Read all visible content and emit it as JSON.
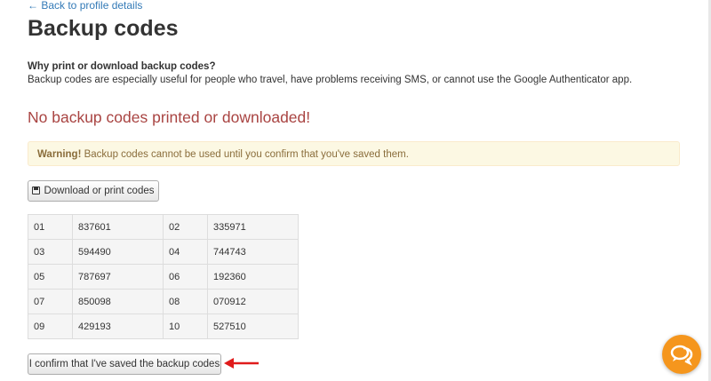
{
  "nav": {
    "back_label": "← Back to profile details"
  },
  "page": {
    "title": "Backup codes"
  },
  "info": {
    "question": "Why print or download backup codes?",
    "explanation": "Backup codes are especially useful for people who travel, have problems receiving SMS, or cannot use the Google Authenticator app."
  },
  "status": {
    "message": "No backup codes printed or downloaded!"
  },
  "warning": {
    "label": "Warning!",
    "text": " Backup codes cannot be used until you confirm that you've saved them."
  },
  "actions": {
    "download_label": "Download or print codes",
    "confirm_label": "I confirm that I've saved the backup codes"
  },
  "codes": [
    [
      {
        "num": "01",
        "code": "837601"
      },
      {
        "num": "02",
        "code": "335971"
      }
    ],
    [
      {
        "num": "03",
        "code": "594490"
      },
      {
        "num": "04",
        "code": "744743"
      }
    ],
    [
      {
        "num": "05",
        "code": "787697"
      },
      {
        "num": "06",
        "code": "192360"
      }
    ],
    [
      {
        "num": "07",
        "code": "850098"
      },
      {
        "num": "08",
        "code": "070912"
      }
    ],
    [
      {
        "num": "09",
        "code": "429193"
      },
      {
        "num": "10",
        "code": "527510"
      }
    ]
  ],
  "colors": {
    "link": "#337ab7",
    "danger": "#a94442",
    "warning_text": "#8a6d3b",
    "warning_bg": "#fcf8e3",
    "chat_accent": "#f5961d",
    "annotation_arrow": "#e01b1b"
  },
  "icons": {
    "download": "floppy-disk-icon",
    "chat": "chat-bubbles-icon",
    "annotation": "red-arrow-icon"
  }
}
